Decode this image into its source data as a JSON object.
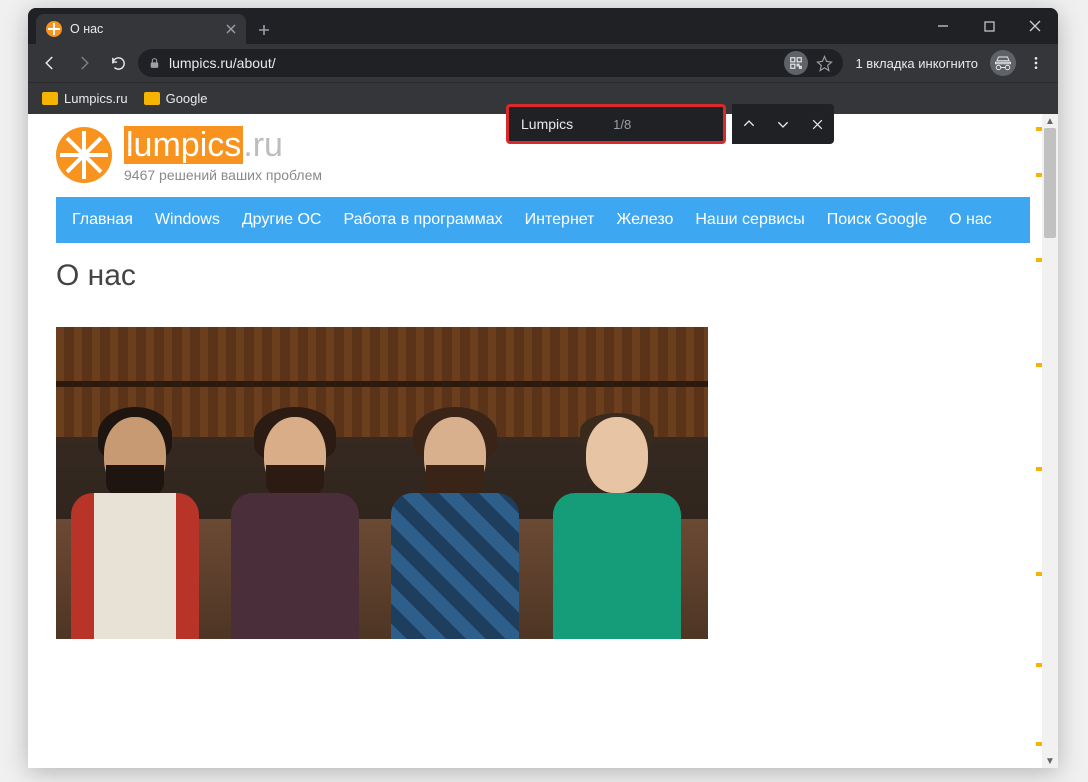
{
  "browser": {
    "tab_title": "О нас",
    "url": "lumpics.ru/about/",
    "incognito_label": "1 вкладка инкогнито",
    "bookmarks": [
      "Lumpics.ru",
      "Google"
    ]
  },
  "findbar": {
    "query": "Lumpics",
    "count": "1/8"
  },
  "site": {
    "logo_highlight": "lumpics",
    "logo_ru": ".ru",
    "tagline": "9467 решений ваших проблем"
  },
  "nav": {
    "items": [
      "Главная",
      "Windows",
      "Другие ОС",
      "Работа в программах",
      "Интернет",
      "Железо",
      "Наши сервисы",
      "Поиск Google",
      "О нас"
    ]
  },
  "content": {
    "heading": "О нас"
  }
}
